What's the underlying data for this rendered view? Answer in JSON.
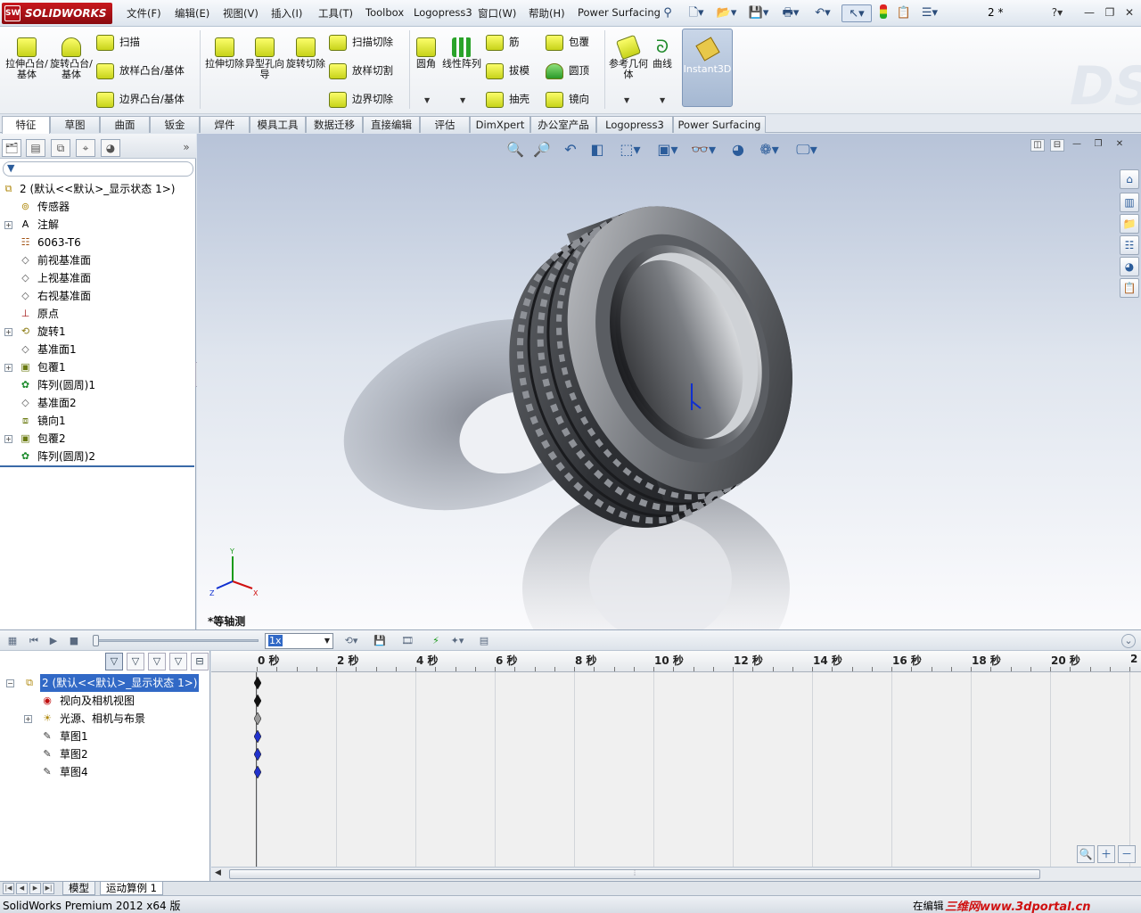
{
  "app": {
    "logo_text": "SOLIDWORKS",
    "doc_title": "2 *"
  },
  "menu": [
    "文件(F)",
    "编辑(E)",
    "视图(V)",
    "插入(I)",
    "工具(T)",
    "Toolbox",
    "Logopress3",
    "窗口(W)",
    "帮助(H)",
    "Power Surfacing"
  ],
  "commands": {
    "extrude_boss": "拉伸凸台/基体",
    "revolve_boss": "旋转凸台/基体",
    "sweep": "扫描",
    "loft_boss": "放样凸台/基体",
    "boundary_boss": "边界凸台/基体",
    "extrude_cut": "拉伸切除",
    "hole_wizard": "异型孔向导",
    "revolve_cut": "旋转切除",
    "sweep_cut": "扫描切除",
    "loft_cut": "放样切割",
    "boundary_cut": "边界切除",
    "fillet": "圆角",
    "linear_pattern": "线性阵列",
    "rib": "筋",
    "draft": "拔模",
    "shell": "抽壳",
    "wrap": "包覆",
    "dome": "圆顶",
    "mirror": "镜向",
    "ref_geometry": "参考几何体",
    "curves": "曲线",
    "instant3d": "Instant3D"
  },
  "tabs": [
    "特征",
    "草图",
    "曲面",
    "钣金",
    "焊件",
    "模具工具",
    "数据迁移",
    "直接编辑",
    "评估",
    "DimXpert",
    "办公室产品",
    "Logopress3",
    "Power Surfacing"
  ],
  "feature_tree": {
    "root": "2  (默认<<默认>_显示状态 1>)",
    "items": [
      {
        "label": "传感器",
        "icon": "sensor-icon",
        "expandable": false
      },
      {
        "label": "注解",
        "icon": "annotation-icon",
        "expandable": true
      },
      {
        "label": "6063-T6",
        "icon": "material-icon",
        "expandable": false
      },
      {
        "label": "前视基准面",
        "icon": "plane-icon",
        "expandable": false
      },
      {
        "label": "上视基准面",
        "icon": "plane-icon",
        "expandable": false
      },
      {
        "label": "右视基准面",
        "icon": "plane-icon",
        "expandable": false
      },
      {
        "label": "原点",
        "icon": "origin-icon",
        "expandable": false
      },
      {
        "label": "旋转1",
        "icon": "revolve-icon",
        "expandable": true
      },
      {
        "label": "基准面1",
        "icon": "plane-icon",
        "expandable": false
      },
      {
        "label": "包覆1",
        "icon": "wrap-icon",
        "expandable": true
      },
      {
        "label": "阵列(圆周)1",
        "icon": "circular-pattern-icon",
        "expandable": false
      },
      {
        "label": "基准面2",
        "icon": "plane-icon",
        "expandable": false
      },
      {
        "label": "镜向1",
        "icon": "mirror-icon",
        "expandable": false
      },
      {
        "label": "包覆2",
        "icon": "wrap-icon",
        "expandable": true
      },
      {
        "label": "阵列(圆周)2",
        "icon": "circular-pattern-icon",
        "expandable": false
      }
    ]
  },
  "viewport": {
    "view_name": "*等轴测",
    "triad_x": "X",
    "triad_y": "Y",
    "triad_z": "Z"
  },
  "motion": {
    "speed": "1x",
    "tree": [
      {
        "label": "2  (默认<<默认>_显示状态 1>)",
        "icon": "assembly-icon",
        "selected": true
      },
      {
        "label": "视向及相机视图",
        "icon": "camera-icon"
      },
      {
        "label": "光源、相机与布景",
        "icon": "lights-icon"
      },
      {
        "label": "草图1",
        "icon": "sketch-icon"
      },
      {
        "label": "草图2",
        "icon": "sketch-icon"
      },
      {
        "label": "草图4",
        "icon": "sketch-icon"
      }
    ],
    "ticks": [
      "0 秒",
      "2 秒",
      "4 秒",
      "6 秒",
      "8 秒",
      "10 秒",
      "12 秒",
      "14 秒",
      "16 秒",
      "18 秒",
      "20 秒",
      "2"
    ],
    "keyframe_colors": [
      "#111111",
      "#111111",
      "#9a9a9a",
      "#2233cc",
      "#2233cc",
      "#2233cc"
    ]
  },
  "bottom_tabs": [
    "模型",
    "运动算例 1"
  ],
  "status": {
    "left": "SolidWorks Premium 2012 x64 版",
    "right": "在编辑",
    "watermark": "三维网www.3dportal.cn"
  }
}
